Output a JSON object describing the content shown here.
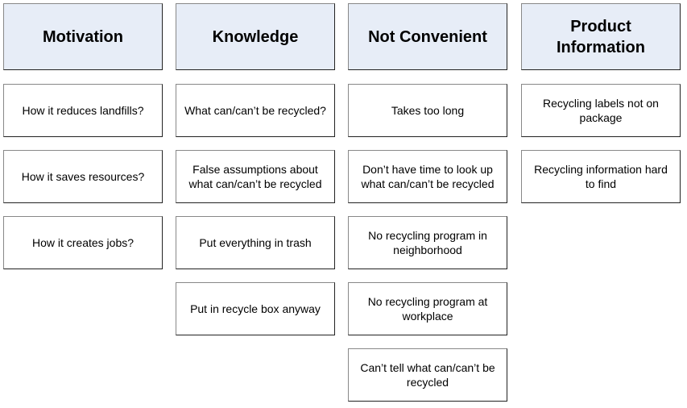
{
  "columns": [
    {
      "title": "Motivation",
      "items": [
        "How it reduces landfills?",
        "How it saves resources?",
        "How it creates jobs?"
      ]
    },
    {
      "title": "Knowledge",
      "items": [
        "What can/can’t be recycled?",
        "False assumptions about what can/can’t be recycled",
        "Put everything in trash",
        "Put in recycle box anyway"
      ]
    },
    {
      "title": "Not Convenient",
      "items": [
        "Takes too long",
        "Don’t have time to look up what can/can’t be recycled",
        "No recycling program in neighborhood",
        "No recycling program at workplace",
        "Can’t tell what can/can’t be recycled"
      ]
    },
    {
      "title": "Product Information",
      "items": [
        "Recycling labels not on package",
        "Recycling information hard to find"
      ]
    }
  ],
  "colors": {
    "header_fill": "#e7edf7",
    "card_fill": "#ffffff",
    "border": "#222222"
  }
}
